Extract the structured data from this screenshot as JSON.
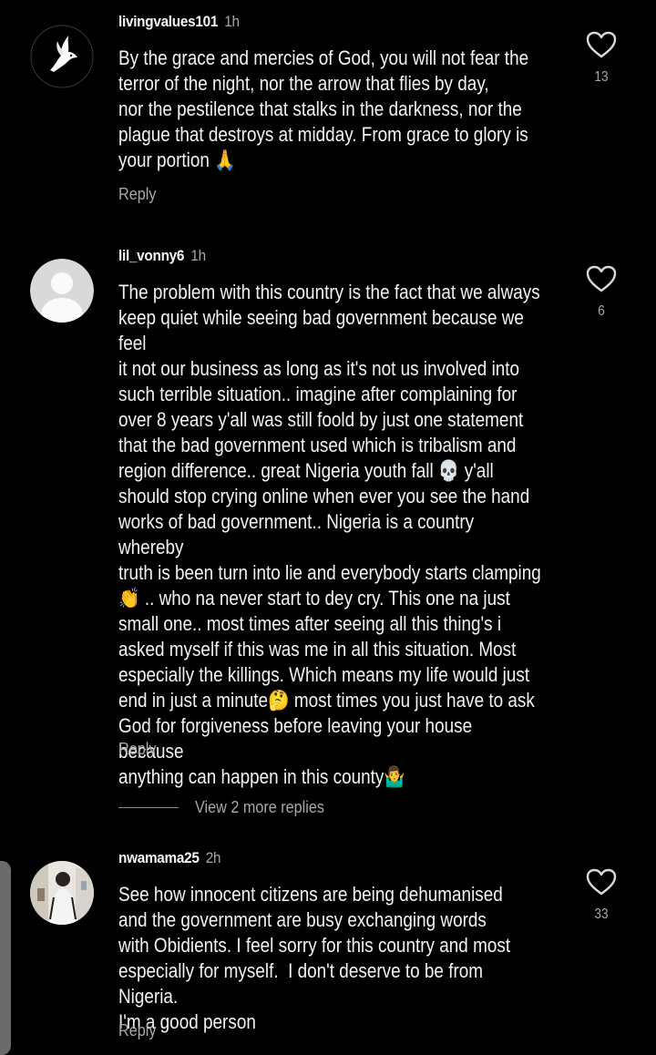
{
  "comments": [
    {
      "username": "livingvalues101",
      "time": "1h",
      "text": "By the grace and mercies of God, you will not fear the\nterror of the night, nor the arrow that flies by day,\nnor the pestilence that stalks in the darkness, nor the\nplague that destroys at midday. From grace to glory is\nyour portion 🙏",
      "reply_label": "Reply",
      "likes": "13",
      "avatar": "dove-avatar"
    },
    {
      "username": "lil_vonny6",
      "time": "1h",
      "text": "The problem with this country is the fact that we always\nkeep quiet while seeing bad government because we feel\nit not our business as long as it's not us involved into\nsuch terrible situation.. imagine after complaining for\nover 8 years y'all was still foold by just one statement\nthat the bad government used which is tribalism and\nregion difference.. great Nigeria youth fall 💀 y'all\nshould stop crying online when ever you see the hand\nworks of bad government.. Nigeria is a country whereby\ntruth is been turn into lie and everybody starts clamping\n👏 .. who na never start to dey cry. This one na just\nsmall one.. most times after seeing all this thing's i\nasked myself if this was me in all this situation. Most\nespecially the killings. Which means my life would just\nend in just a minute🤔 most times you just have to ask\nGod for forgiveness before leaving your house because\nanything can happen in this county🤷‍♂️",
      "reply_label": "Reply",
      "likes": "6",
      "avatar": "default-avatar",
      "view_more": "View 2 more replies"
    },
    {
      "username": "nwamama25",
      "time": "2h",
      "text": "See how innocent citizens are being dehumanised\nand the government are busy exchanging words\nwith Obidients. I feel sorry for this country and most\nespecially for myself.  I don't deserve to be from Nigeria.\nI'm a good person",
      "reply_label": "Reply",
      "likes": "33",
      "avatar": "photo-avatar"
    }
  ],
  "colors": {
    "background": "#000000",
    "text": "#f2f2f2",
    "secondary": "#a8a8a8"
  }
}
